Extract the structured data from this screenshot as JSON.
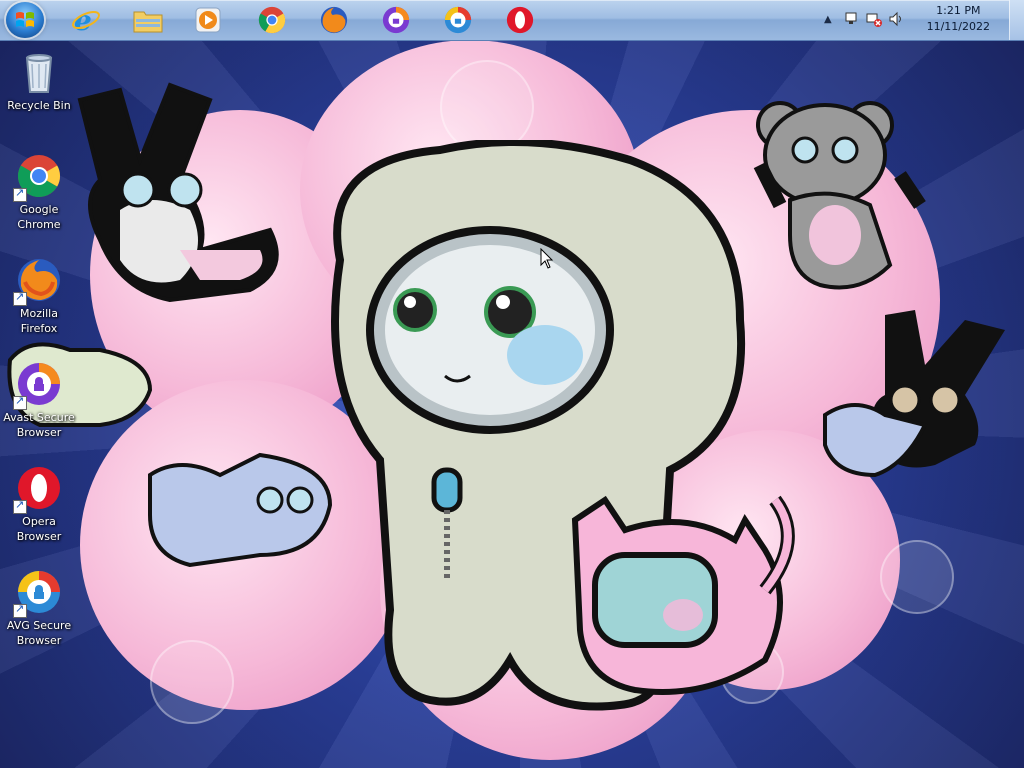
{
  "taskbar": {
    "pinned": [
      {
        "name": "internet-explorer-icon"
      },
      {
        "name": "file-explorer-icon"
      },
      {
        "name": "media-player-icon"
      },
      {
        "name": "chrome-icon"
      },
      {
        "name": "firefox-icon"
      },
      {
        "name": "avast-browser-icon"
      },
      {
        "name": "avg-browser-icon"
      },
      {
        "name": "opera-icon"
      }
    ],
    "tray": {
      "time": "1:21 PM",
      "date": "11/11/2022"
    }
  },
  "desktop": {
    "icons": [
      {
        "label": "Recycle Bin",
        "icon": "recycle-bin-icon"
      },
      {
        "label": "Google Chrome",
        "icon": "chrome-icon"
      },
      {
        "label": "Mozilla Firefox",
        "icon": "firefox-icon"
      },
      {
        "label": "Avast Secure Browser",
        "icon": "avast-browser-icon"
      },
      {
        "label": "Opera Browser",
        "icon": "opera-icon"
      },
      {
        "label": "AVG Secure Browser",
        "icon": "avg-browser-icon"
      }
    ]
  },
  "colors": {
    "taskbar": "#9fbde3",
    "wallpaper_blue": "#2a3f9a",
    "wallpaper_pink": "#f6b9d8"
  }
}
